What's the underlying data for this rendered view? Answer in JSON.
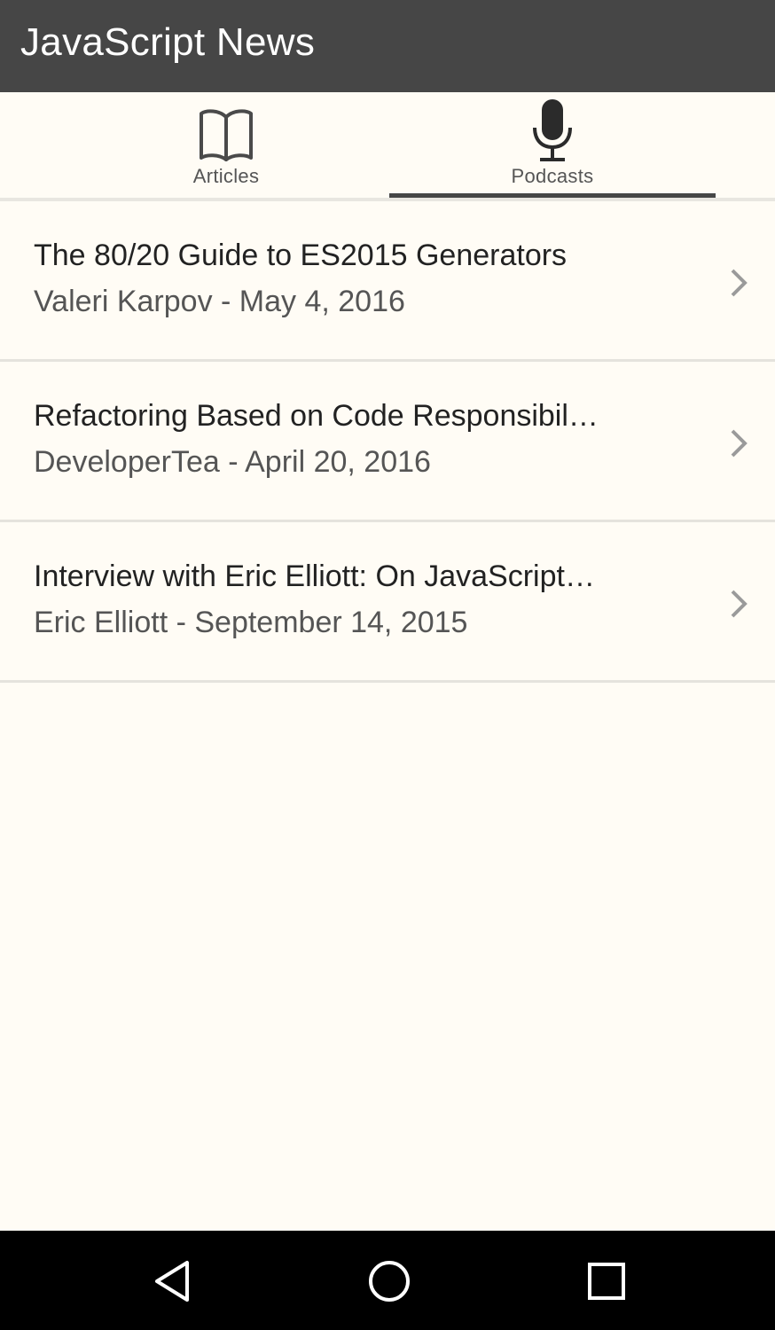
{
  "app_bar": {
    "title": "JavaScript News"
  },
  "tabs": [
    {
      "label": "Articles",
      "icon": "book-icon",
      "selected": false
    },
    {
      "label": "Podcasts",
      "icon": "microphone-icon",
      "selected": true
    }
  ],
  "items": [
    {
      "title": "The 80/20 Guide to ES2015 Generators",
      "subtitle": "Valeri Karpov - May 4, 2016"
    },
    {
      "title": "Refactoring Based on Code Responsibil…",
      "subtitle": "DeveloperTea - April 20, 2016"
    },
    {
      "title": "Interview with Eric Elliott: On JavaScript…",
      "subtitle": "Eric Elliott - September 14, 2015"
    }
  ],
  "nav_bar": {
    "back": "back-triangle-icon",
    "home": "home-circle-icon",
    "recents": "recents-square-icon"
  },
  "colors": {
    "app_bar": "#464646",
    "background": "#fffcf5",
    "indicator": "#464646"
  }
}
